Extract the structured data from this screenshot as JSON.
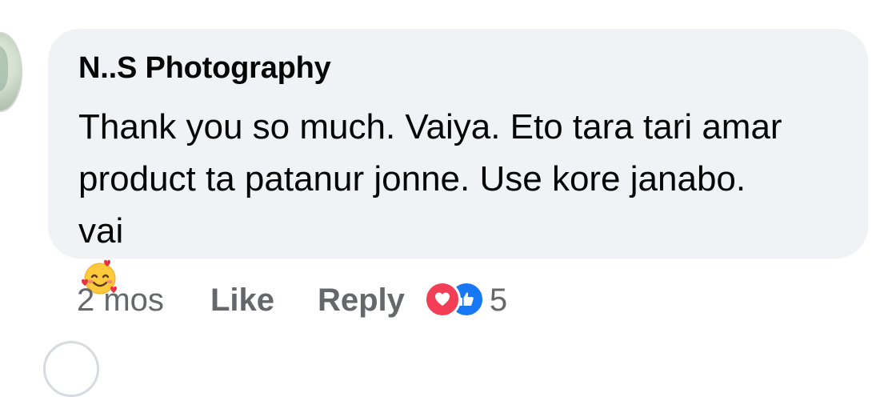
{
  "comment": {
    "author": "N..S Photography",
    "text_lines": [
      "Thank you so much. Vaiya. Eto tara tari amar",
      "product ta patanur jonne. Use kore janabo.",
      "vai"
    ],
    "emoji": "smiling-face-with-hearts"
  },
  "actions": {
    "timestamp": "2 mos",
    "like_label": "Like",
    "reply_label": "Reply"
  },
  "reactions": {
    "types": [
      "love",
      "like"
    ],
    "count": "5"
  },
  "colors": {
    "bubble": "#f0f2f5",
    "text": "#050505",
    "secondary_text": "#65676b",
    "love": "#f33e58",
    "like": "#1877f2"
  }
}
